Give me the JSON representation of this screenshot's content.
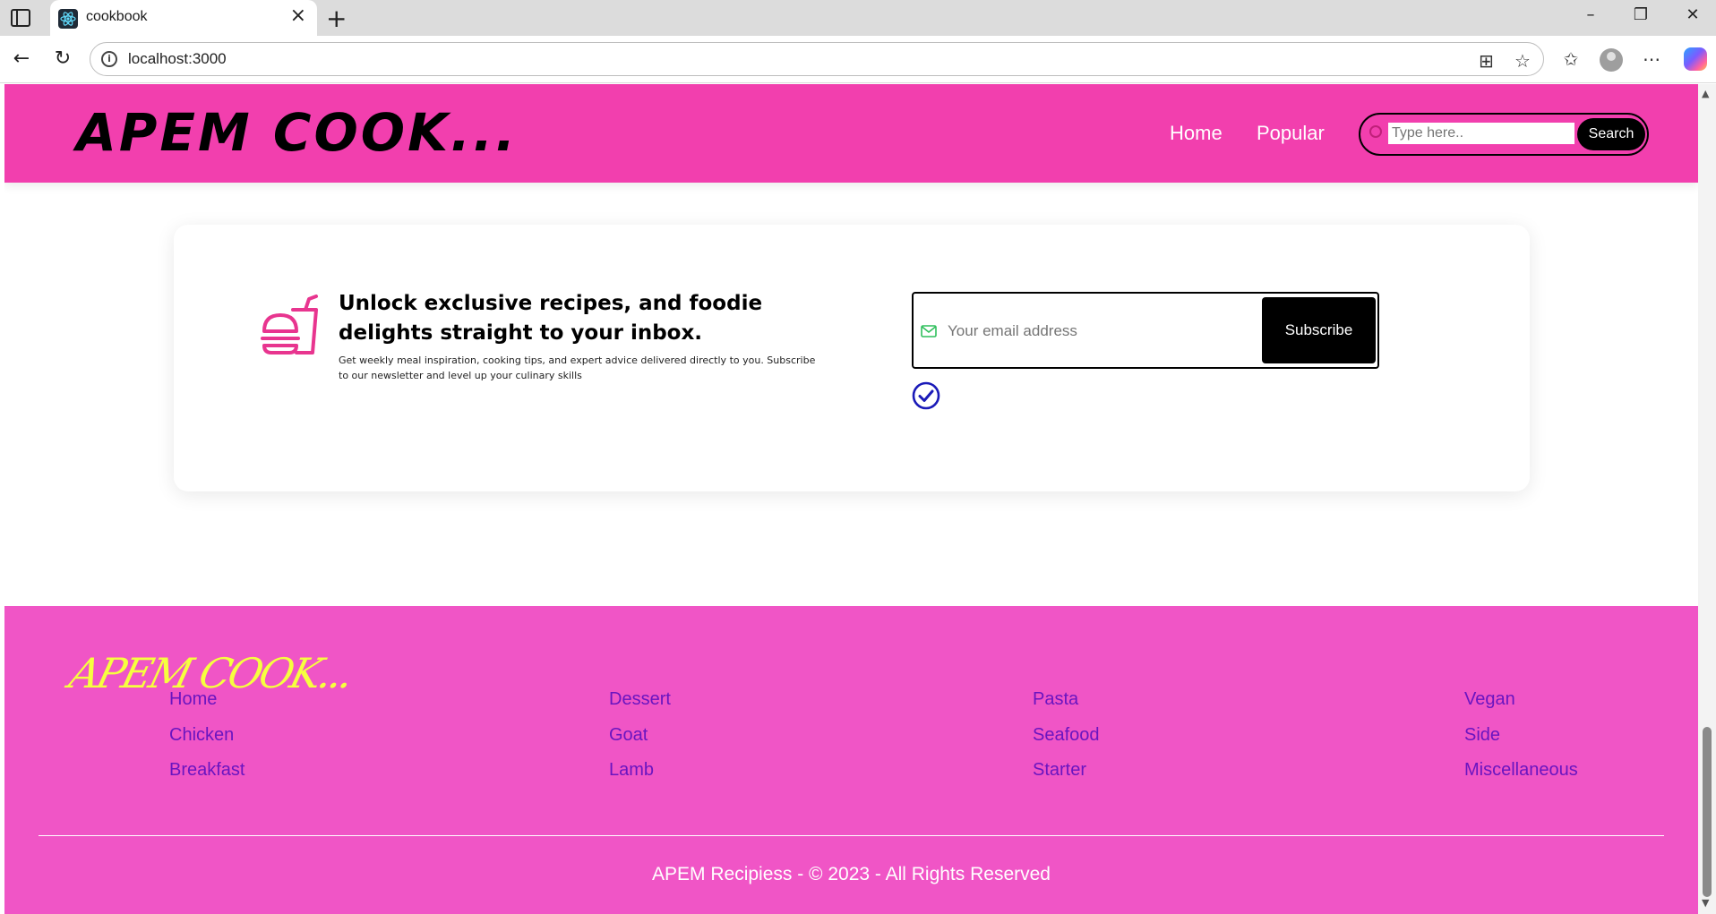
{
  "browser": {
    "tab_title": "cookbook",
    "url": "localhost:3000"
  },
  "header": {
    "brand": "APEM COOK...",
    "nav": [
      "Home",
      "Popular"
    ],
    "search_placeholder": "Type here..",
    "search_button": "Search"
  },
  "newsletter": {
    "title": "Unlock exclusive recipes, and foodie delights straight to your inbox.",
    "description": "Get weekly meal inspiration, cooking tips, and expert advice delivered directly to you. Subscribe to our newsletter and level up your culinary skills",
    "email_placeholder": "Your email address",
    "subscribe_button": "Subscribe"
  },
  "footer": {
    "logo": "APEM COOK...",
    "columns": [
      [
        "Home",
        "Chicken",
        "Breakfast"
      ],
      [
        "Dessert",
        "Goat",
        "Lamb"
      ],
      [
        "Pasta",
        "Seafood",
        "Starter"
      ],
      [
        "Vegan",
        "Side",
        "Miscellaneous"
      ]
    ],
    "copyright": "APEM Recipiess - © 2023 - All Rights Reserved"
  },
  "colors": {
    "header_bg": "#f23fae",
    "footer_bg": "#f055c6",
    "footer_link": "#6a15c0",
    "footer_logo": "#f6ff3f",
    "accent_icon": "#e8358f"
  }
}
